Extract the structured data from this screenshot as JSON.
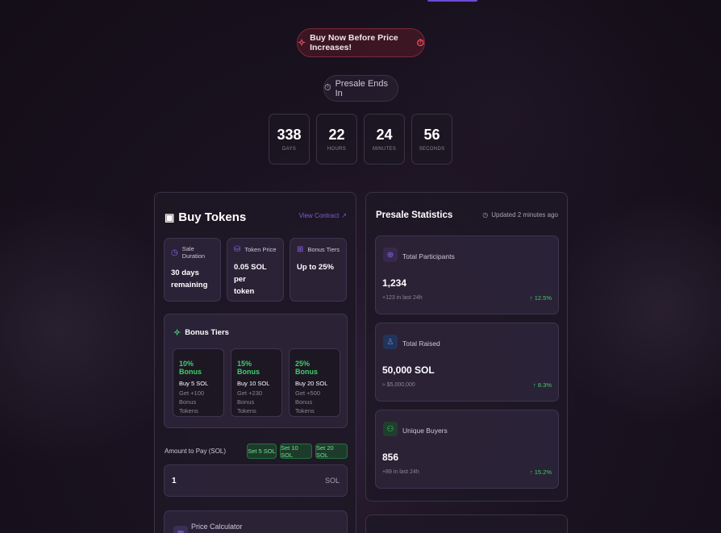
{
  "banner": {
    "urgent_text": "Buy Now Before Price Increases!",
    "ends_text": "Presale Ends In"
  },
  "countdown": [
    {
      "value": "338",
      "unit": "DAYS"
    },
    {
      "value": "22",
      "unit": "HOURS"
    },
    {
      "value": "24",
      "unit": "MINUTES"
    },
    {
      "value": "56",
      "unit": "SECONDS"
    }
  ],
  "buy": {
    "title": "Buy Tokens",
    "view_contract": "View Contract",
    "info": [
      {
        "label": "Sale Duration",
        "value_line1": "30 days",
        "value_line2": "remaining",
        "icon": "clock-icon"
      },
      {
        "label": "Token Price",
        "value_line1": "0.05 SOL per",
        "value_line2": "token",
        "icon": "coins-icon"
      },
      {
        "label": "Bonus Tiers",
        "value_line1": "Up to 25%",
        "value_line2": "",
        "icon": "gift-icon"
      }
    ],
    "tiers_title": "Bonus Tiers",
    "tiers": [
      {
        "pct": "10% Bonus",
        "buy": "Buy 5 SOL",
        "get1": "Get +100 Bonus",
        "get2": "Tokens"
      },
      {
        "pct": "15% Bonus",
        "buy": "Buy 10 SOL",
        "get1": "Get +230 Bonus",
        "get2": "Tokens"
      },
      {
        "pct": "25% Bonus",
        "buy": "Buy 20 SOL",
        "get1": "Get +500 Bonus",
        "get2": "Tokens"
      }
    ],
    "amount_label": "Amount to Pay (SOL)",
    "set_buttons": [
      "Set 5 SOL",
      "Set 10 SOL",
      "Set 20 SOL"
    ],
    "amount_value": "1",
    "amount_unit": "SOL",
    "calculator_label": "Price Calculator"
  },
  "stats": {
    "title": "Presale Statistics",
    "updated": "Updated 2 minutes ago",
    "items": [
      {
        "label": "Total Participants",
        "value": "1,234",
        "sub": "+123 in last 24h",
        "change": "12.5%",
        "icon": "globe-icon",
        "icon_color": "#8b63e8",
        "icon_bg": "#352a4d"
      },
      {
        "label": "Total Raised",
        "value": "50,000 SOL",
        "sub": "≈ $5,000,000",
        "change": "8.3%",
        "icon": "trophy-icon",
        "icon_color": "#5a8ef0",
        "icon_bg": "#223559"
      },
      {
        "label": "Unique Buyers",
        "value": "856",
        "sub": "+89 in last 24h",
        "change": "15.2%",
        "icon": "users-icon",
        "icon_color": "#3fcf6a",
        "icon_bg": "#1f3f2d"
      }
    ]
  }
}
